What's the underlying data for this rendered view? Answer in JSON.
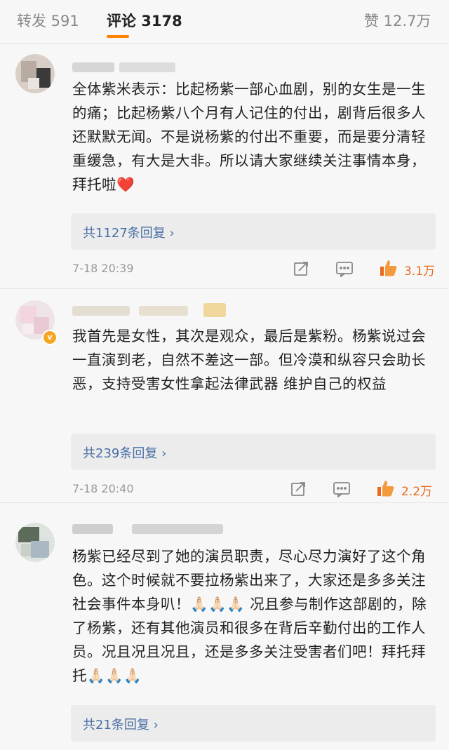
{
  "tabs": {
    "repost": "转发 591",
    "comments": "评论 3178",
    "likes": "赞 12.7万"
  },
  "colors": {
    "accent": "#ff8200",
    "link": "#4a6fa5",
    "like": "#e86a1e"
  },
  "comments": [
    {
      "text": "全体紫米表示：比起杨紫一部心血剧，别的女生是一生的痛；比起杨紫八个月有人记住的付出，剧背后很多人还默默无闻。不是说杨紫的付出不重要，而是要分清轻重缓急，有大是大非。所以请大家继续关注事情本身，拜托啦",
      "emoji": "❤️",
      "replies": "共1127条回复 ›",
      "time": "7-18 20:39",
      "likes": "3.1万"
    },
    {
      "text": "我首先是女性，其次是观众，最后是紫粉。杨紫说过会一直演到老，自然不差这一部。但冷漠和纵容只会助长恶，支持受害女性拿起法律武器 维护自己的权益",
      "replies": "共239条回复 ›",
      "time": "7-18 20:40",
      "likes": "2.2万"
    },
    {
      "text": "杨紫已经尽到了她的演员职责，尽心尽力演好了这个角色。这个时候就不要拉杨紫出来了，大家还是多多关注社会事件本身叭！🙏🏻🙏🏻🙏🏻 况且参与制作这部剧的，除了杨紫，还有其他演员和很多在背后辛勤付出的工作人员。况且况且况且，还是多多关注受害者们吧！拜托拜托🙏🏻🙏🏻🙏🏻",
      "replies": "共21条回复 ›"
    }
  ]
}
